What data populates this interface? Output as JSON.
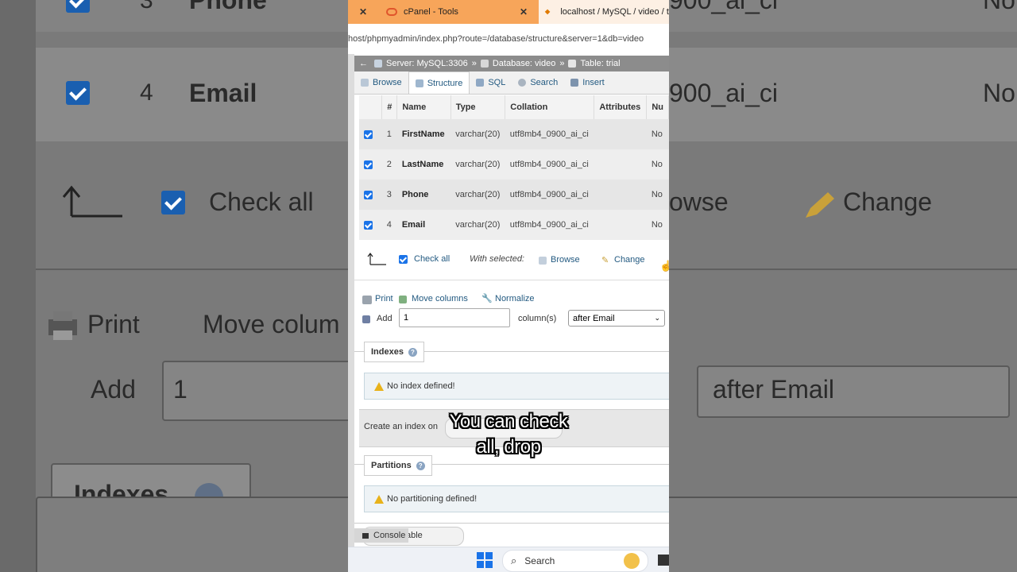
{
  "background": {
    "rows": [
      {
        "num": "3",
        "name": "Phone",
        "collation": "900_ai_ci",
        "null": "No"
      },
      {
        "num": "4",
        "name": "Email",
        "collation": "900_ai_ci",
        "null": "No"
      }
    ],
    "check_all": "Check all",
    "browse": "owse",
    "change": "Change",
    "print": "Print",
    "move_columns": "Move colum",
    "add": "Add",
    "add_value": "1",
    "after": "after Email",
    "indexes": "Indexes"
  },
  "tabs": [
    {
      "label": "cPanel - Tools"
    },
    {
      "label": "localhost / MySQL / video / tri"
    }
  ],
  "url": "host/phpmyadmin/index.php?route=/database/structure&server=1&db=video",
  "breadcrumb": {
    "server": "Server: MySQL:3306",
    "database": "Database: video",
    "table": "Table: trial",
    "sep": "»"
  },
  "menu": [
    "Browse",
    "Structure",
    "SQL",
    "Search",
    "Insert"
  ],
  "columns_header": [
    "#",
    "Name",
    "Type",
    "Collation",
    "Attributes",
    "Nu"
  ],
  "columns": [
    {
      "num": "1",
      "name": "FirstName",
      "type": "varchar(20)",
      "collation": "utf8mb4_0900_ai_ci",
      "null": "No"
    },
    {
      "num": "2",
      "name": "LastName",
      "type": "varchar(20)",
      "collation": "utf8mb4_0900_ai_ci",
      "null": "No"
    },
    {
      "num": "3",
      "name": "Phone",
      "type": "varchar(20)",
      "collation": "utf8mb4_0900_ai_ci",
      "null": "No"
    },
    {
      "num": "4",
      "name": "Email",
      "type": "varchar(20)",
      "collation": "utf8mb4_0900_ai_ci",
      "null": "No"
    }
  ],
  "bulk": {
    "check_all": "Check all",
    "with_selected": "With selected:",
    "browse": "Browse",
    "change": "Change"
  },
  "actions": {
    "print": "Print",
    "move_columns": "Move columns",
    "normalize": "Normalize",
    "add": "Add",
    "add_value": "1",
    "columns_suffix": "column(s)",
    "position": "after Email"
  },
  "indexes": {
    "title": "Indexes",
    "notice": "No index defined!",
    "create": "Create an index on"
  },
  "partitions": {
    "title": "Partitions",
    "notice": "No partitioning defined!"
  },
  "console": {
    "label": "Console",
    "tail": "able"
  },
  "taskbar": {
    "search": "Search"
  },
  "caption": {
    "line1": "You can check",
    "line2": "all, drop"
  },
  "colors": {
    "tab_bar": "#f7a55a",
    "accent": "#235a81",
    "checkbox": "#1a73e8"
  }
}
